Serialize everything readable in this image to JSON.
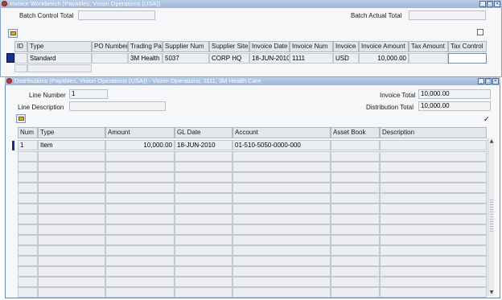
{
  "workbench": {
    "title": "Invoice Workbench (Payables, Vision Operations (USA))",
    "batch_control_total_label": "Batch Control Total",
    "batch_control_total_value": "",
    "batch_actual_total_label": "Batch Actual Total",
    "batch_actual_total_value": "",
    "columns": [
      "ID",
      "Type",
      "PO Number",
      "Trading Pa",
      "Supplier Num",
      "Supplier Site",
      "Invoice Date",
      "Invoice Num",
      "Invoice",
      "Invoice Amount",
      "Tax Amount",
      "Tax Control"
    ],
    "row": {
      "type": "Standard",
      "po_number": "",
      "trading_partner": "3M Health",
      "supplier_num": "5037",
      "supplier_site": "CORP HQ",
      "invoice_date": "18-JUN-2010",
      "invoice_num": "1111",
      "currency": "USD",
      "invoice_amount": "10,000.00",
      "tax_amount": "",
      "tax_control": ""
    }
  },
  "distributions": {
    "title": "Distributions (Payables, Vision Operations (USA)) - Vision Operations, 1111, 3M Health Care",
    "line_number_label": "Line Number",
    "line_number_value": "1",
    "line_description_label": "Line Description",
    "line_description_value": "",
    "invoice_total_label": "Invoice Total",
    "invoice_total_value": "10,000.00",
    "distribution_total_label": "Distribution Total",
    "distribution_total_value": "10,000.00",
    "columns": [
      "Num",
      "Type",
      "Amount",
      "GL Date",
      "Account",
      "Asset Book",
      "Description"
    ],
    "rows": [
      {
        "num": "1",
        "type": "Item",
        "amount": "10,000.00",
        "gl_date": "18-JUN-2010",
        "account": "01-510-5050-0000-000",
        "asset_book": "",
        "description": ""
      }
    ],
    "empty_row_count": 14
  },
  "colors": {
    "titlebar": "#9fb6d9",
    "selected_row": "#1c2f86",
    "field_bg": "#f2f3f5"
  }
}
